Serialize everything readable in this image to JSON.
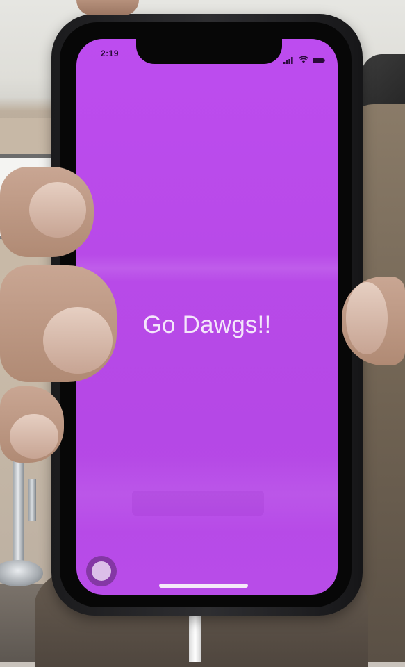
{
  "status_bar": {
    "time": "2:19",
    "icons": [
      "signal-icon",
      "wifi-icon",
      "battery-icon"
    ]
  },
  "screen": {
    "background_color": "#b84ae8",
    "headline": "Go Dawgs!!",
    "headline_color": "#f4e6fb"
  },
  "controls": {
    "assistive_touch": "assistive-touch-button",
    "home_indicator": "home-indicator"
  }
}
